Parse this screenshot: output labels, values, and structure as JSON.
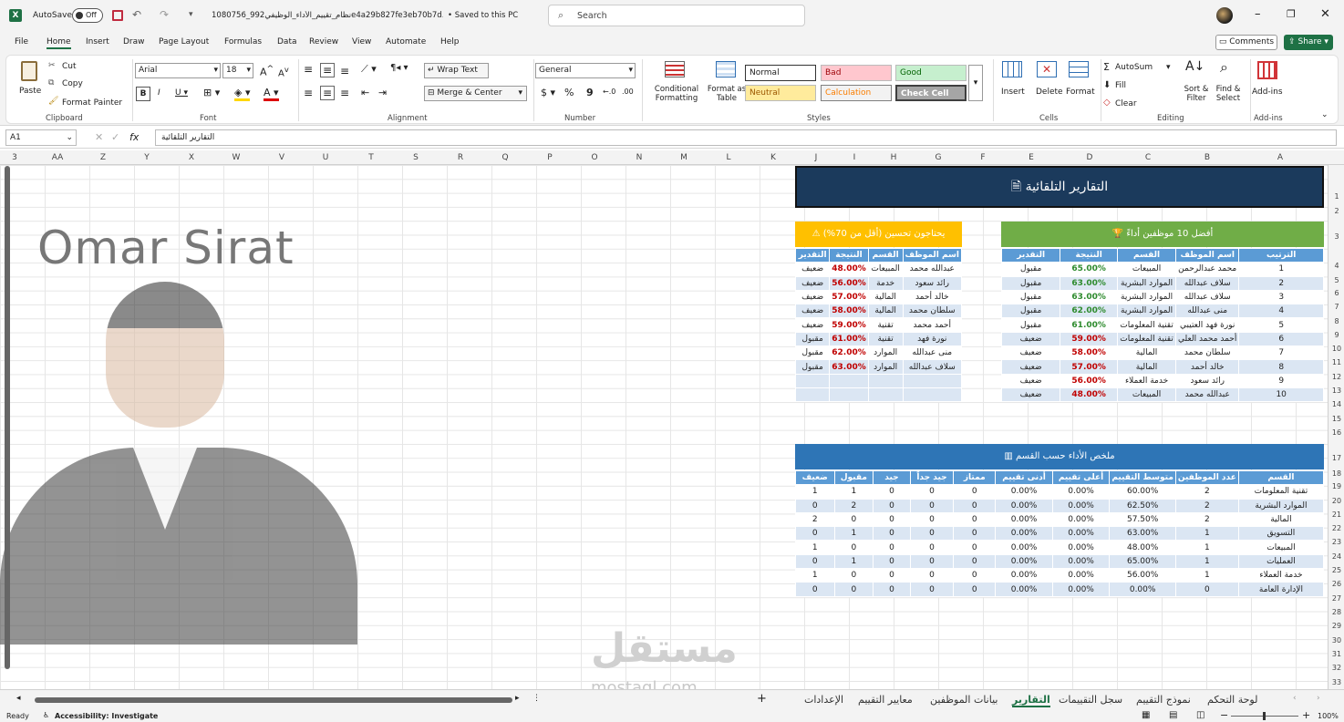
{
  "titlebar": {
    "autosave": "AutoSave",
    "toggle": "Off",
    "filename": "1080756_نظام_تقييم_الأداء_الوظيفي992e4a29b827fe3eb70b7d...",
    "saved": "• Saved to this PC",
    "search_placeholder": "Search"
  },
  "menu": [
    "File",
    "Home",
    "Insert",
    "Draw",
    "Page Layout",
    "Formulas",
    "Data",
    "Review",
    "View",
    "Automate",
    "Help"
  ],
  "menu_right": {
    "comments": "Comments",
    "share": "Share"
  },
  "ribbon": {
    "clipboard": {
      "paste": "Paste",
      "cut": "Cut",
      "copy": "Copy",
      "format_painter": "Format Painter",
      "label": "Clipboard"
    },
    "font": {
      "name": "Arial",
      "size": "18",
      "label": "Font"
    },
    "alignment": {
      "wrap": "Wrap Text",
      "merge": "Merge & Center",
      "label": "Alignment"
    },
    "number": {
      "format": "General",
      "label": "Number"
    },
    "styles": {
      "cond": "Conditional Formatting",
      "table": "Format as Table",
      "normal": "Normal",
      "bad": "Bad",
      "good": "Good",
      "neutral": "Neutral",
      "calculation": "Calculation",
      "check": "Check Cell",
      "label": "Styles"
    },
    "cells": {
      "insert": "Insert",
      "delete": "Delete",
      "format": "Format",
      "label": "Cells"
    },
    "editing": {
      "autosum": "AutoSum",
      "fill": "Fill",
      "clear": "Clear",
      "sort": "Sort & Filter",
      "find": "Find & Select",
      "label": "Editing"
    },
    "addins": {
      "addins": "Add-ins",
      "label": "Add-ins"
    }
  },
  "formula": {
    "cell": "A1",
    "fx": "fx",
    "content": "التقارير التلقائية"
  },
  "columns": [
    "3",
    "AA",
    "Z",
    "Y",
    "X",
    "W",
    "V",
    "U",
    "T",
    "S",
    "R",
    "Q",
    "P",
    "O",
    "N",
    "M",
    "L",
    "K",
    "J",
    "I",
    "H",
    "G",
    "F",
    "E",
    "D",
    "C",
    "B",
    "A"
  ],
  "rows": [
    "1",
    "2",
    "3",
    "4",
    "5",
    "6",
    "7",
    "8",
    "9",
    "10",
    "11",
    "12",
    "13",
    "14",
    "15",
    "16",
    "17",
    "18",
    "19",
    "20",
    "21",
    "22",
    "23",
    "24",
    "25",
    "26",
    "27",
    "28",
    "29",
    "30",
    "31",
    "32",
    "33"
  ],
  "watermark_name": "Omar Sirat",
  "banner_title": "التقارير التلقائية",
  "top10": {
    "title": "أفضل 10 موظفين أداءً",
    "headers": [
      "الترتيب",
      "اسم الموظف",
      "القسم",
      "النتيجة",
      "التقدير"
    ],
    "rows": [
      [
        "1",
        "محمد عبدالرحمن",
        "المبيعات",
        "65.00%",
        "مقبول"
      ],
      [
        "2",
        "سلاف عبدالله",
        "الموارد البشرية",
        "63.00%",
        "مقبول"
      ],
      [
        "3",
        "سلاف عبدالله",
        "الموارد البشرية",
        "63.00%",
        "مقبول"
      ],
      [
        "4",
        "منى عبدالله",
        "الموارد البشرية",
        "62.00%",
        "مقبول"
      ],
      [
        "5",
        "نورة فهد العتيبي",
        "تقنية المعلومات",
        "61.00%",
        "مقبول"
      ],
      [
        "6",
        "أحمد محمد العلي",
        "تقنية المعلومات",
        "59.00%",
        "ضعيف"
      ],
      [
        "7",
        "سلطان محمد",
        "المالية",
        "58.00%",
        "ضعيف"
      ],
      [
        "8",
        "خالد أحمد",
        "المالية",
        "57.00%",
        "ضعيف"
      ],
      [
        "9",
        "رائد سعود",
        "خدمة العملاء",
        "56.00%",
        "ضعيف"
      ],
      [
        "10",
        "عبدالله محمد",
        "المبيعات",
        "48.00%",
        "ضعيف"
      ]
    ]
  },
  "improve": {
    "title": "يحتاجون تحسين (أقل من 70%)",
    "headers": [
      "اسم الموظف",
      "القسم",
      "النتيجة",
      "التقدير"
    ],
    "rows": [
      [
        "عبدالله محمد",
        "المبيعات",
        "48.00%",
        "ضعيف"
      ],
      [
        "رائد سعود",
        "خدمة",
        "56.00%",
        "ضعيف"
      ],
      [
        "خالد أحمد",
        "المالية",
        "57.00%",
        "ضعيف"
      ],
      [
        "سلطان محمد",
        "المالية",
        "58.00%",
        "ضعيف"
      ],
      [
        "أحمد محمد",
        "تقنية",
        "59.00%",
        "ضعيف"
      ],
      [
        "نورة فهد",
        "تقنية",
        "61.00%",
        "مقبول"
      ],
      [
        "منى عبدالله",
        "الموارد",
        "62.00%",
        "مقبول"
      ],
      [
        "سلاف عبدالله",
        "الموارد",
        "63.00%",
        "مقبول"
      ]
    ]
  },
  "summary": {
    "title": "ملخص الأداء حسب القسم",
    "headers": [
      "القسم",
      "عدد الموظفين",
      "متوسط التقييم",
      "أعلى تقييم",
      "أدنى تقييم",
      "ممتاز",
      "جيد جداً",
      "جيد",
      "مقبول",
      "ضعيف"
    ],
    "rows": [
      [
        "تقنية المعلومات",
        "2",
        "60.00%",
        "0.00%",
        "0.00%",
        "0",
        "0",
        "0",
        "1",
        "1"
      ],
      [
        "الموارد البشرية",
        "2",
        "62.50%",
        "0.00%",
        "0.00%",
        "0",
        "0",
        "0",
        "2",
        "0"
      ],
      [
        "المالية",
        "2",
        "57.50%",
        "0.00%",
        "0.00%",
        "0",
        "0",
        "0",
        "0",
        "2"
      ],
      [
        "التسويق",
        "1",
        "63.00%",
        "0.00%",
        "0.00%",
        "0",
        "0",
        "0",
        "1",
        "0"
      ],
      [
        "المبيعات",
        "1",
        "48.00%",
        "0.00%",
        "0.00%",
        "0",
        "0",
        "0",
        "0",
        "1"
      ],
      [
        "العمليات",
        "1",
        "65.00%",
        "0.00%",
        "0.00%",
        "0",
        "0",
        "0",
        "1",
        "0"
      ],
      [
        "خدمة العملاء",
        "1",
        "56.00%",
        "0.00%",
        "0.00%",
        "0",
        "0",
        "0",
        "0",
        "1"
      ],
      [
        "الإدارة العامة",
        "0",
        "0.00%",
        "0.00%",
        "0.00%",
        "0",
        "0",
        "0",
        "0",
        "0"
      ]
    ]
  },
  "tabs": [
    "لوحة التحكم",
    "نموذج التقييم",
    "سجل التقييمات",
    "التقارير",
    "بيانات الموظفين",
    "معايير التقييم",
    "الإعدادات"
  ],
  "active_tab": "التقارير",
  "status": {
    "ready": "Ready",
    "accessibility": "Accessibility: Investigate",
    "zoom": "100%"
  },
  "watermark": {
    "logo": "مستقل",
    "url": "mostaql.com"
  }
}
